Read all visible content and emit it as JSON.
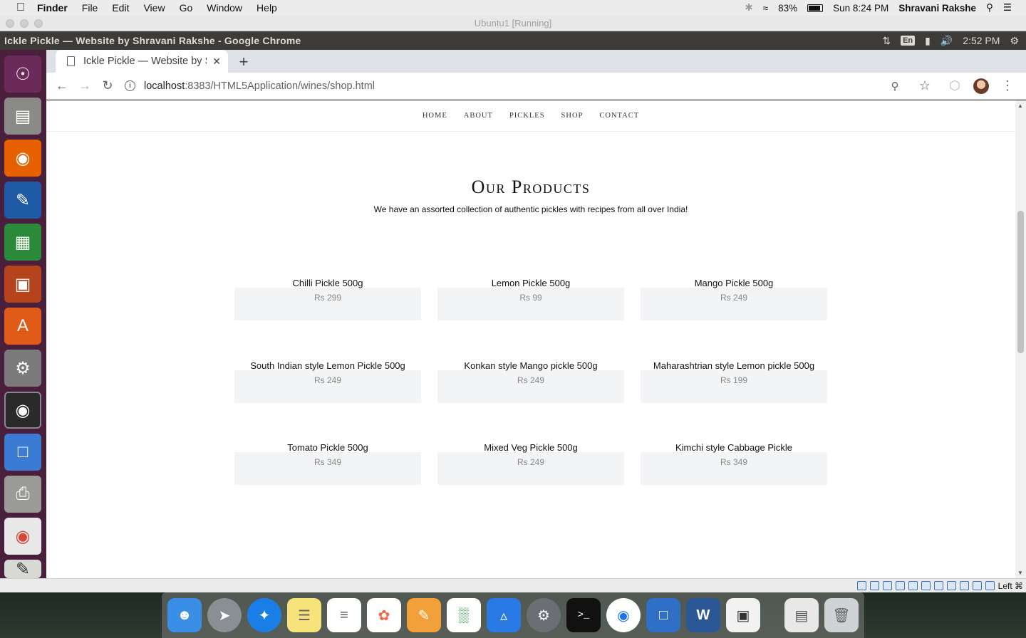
{
  "mac_menubar": {
    "apple": "",
    "app": "Finder",
    "menus": [
      "File",
      "Edit",
      "View",
      "Go",
      "Window",
      "Help"
    ],
    "battery": "83%",
    "datetime": "Sun 8:24 PM",
    "user": "Shravani Rakshe"
  },
  "vbox": {
    "title": "Ubuntu1 [Running]",
    "status_right": "Left ⌘"
  },
  "ubuntu": {
    "window_title": "Ickle Pickle — Website by Shravani Rakshe - Google Chrome",
    "lang": "En",
    "time": "2:52 PM"
  },
  "chrome": {
    "tab_title": "Ickle Pickle — Website by Shravani Rakshe",
    "url_host": "localhost",
    "url_path": ":8383/HTML5Application/wines/shop.html"
  },
  "site": {
    "nav": [
      "HOME",
      "ABOUT",
      "PICKLES",
      "SHOP",
      "CONTACT"
    ],
    "heading": "Our Products",
    "subheading": "We have an assorted collection of authentic pickles with recipes from all over India!",
    "products": [
      {
        "name": "Chilli Pickle 500g",
        "price": "Rs 299"
      },
      {
        "name": "Lemon Pickle 500g",
        "price": "Rs 99"
      },
      {
        "name": "Mango Pickle 500g",
        "price": "Rs 249"
      },
      {
        "name": "South Indian style Lemon Pickle 500g",
        "price": "Rs 249"
      },
      {
        "name": "Konkan style Mango pickle 500g",
        "price": "Rs 249"
      },
      {
        "name": "Maharashtrian style Lemon pickle 500g",
        "price": "Rs 199"
      },
      {
        "name": "Tomato Pickle 500g",
        "price": "Rs 349"
      },
      {
        "name": "Mixed Veg Pickle 500g",
        "price": "Rs 249"
      },
      {
        "name": "Kimchi style Cabbage Pickle",
        "price": "Rs 349"
      }
    ]
  },
  "colors": {
    "launcher_bg": "#4a1f3c",
    "ubuntu_bar": "#3c3b37",
    "product_box": "#f3f4f6"
  }
}
